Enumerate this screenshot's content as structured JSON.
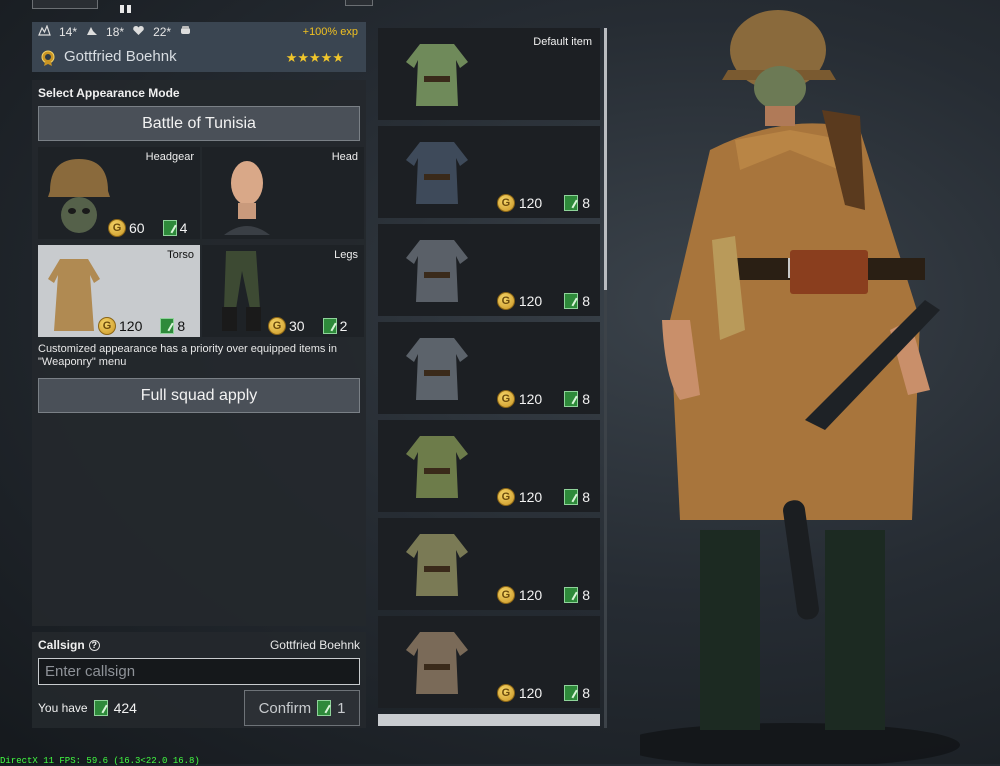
{
  "soldier": {
    "stats": [
      {
        "icon": "perk-points-icon",
        "value": "14*"
      },
      {
        "icon": "speed-icon",
        "value": "18*"
      },
      {
        "icon": "health-icon",
        "value": "22*"
      },
      {
        "icon": "strength-icon",
        "value": ""
      }
    ],
    "exp_bonus": "+100% exp",
    "name": "Gottfried Boehnk",
    "stars": "★★★★★"
  },
  "appearance": {
    "mode_label": "Select Appearance Mode",
    "mode_value": "Battle of Tunisia",
    "slots": [
      {
        "label": "Headgear",
        "price_gold": "60",
        "price_tickets": "4",
        "selected": false
      },
      {
        "label": "Head",
        "price_gold": "",
        "price_tickets": "",
        "selected": false
      },
      {
        "label": "Torso",
        "price_gold": "120",
        "price_tickets": "8",
        "selected": true
      },
      {
        "label": "Legs",
        "price_gold": "30",
        "price_tickets": "2",
        "selected": false
      }
    ],
    "note": "Customized appearance has a priority over equipped items in \"Weaponry\" menu",
    "squad_apply_label": "Full squad apply"
  },
  "callsign": {
    "label": "Callsign",
    "help_icon": "?",
    "current_name": "Gottfried Boehnk",
    "placeholder": "Enter callsign",
    "you_have_label": "You have",
    "you_have_amount": "424",
    "confirm_label": "Confirm",
    "confirm_cost": "1"
  },
  "items": [
    {
      "label": "Default item",
      "price_gold": "",
      "price_tickets": "",
      "color": "#6f8a5a"
    },
    {
      "label": "",
      "price_gold": "120",
      "price_tickets": "8",
      "color": "#3e4a5a"
    },
    {
      "label": "",
      "price_gold": "120",
      "price_tickets": "8",
      "color": "#5a6068"
    },
    {
      "label": "",
      "price_gold": "120",
      "price_tickets": "8",
      "color": "#5c636b"
    },
    {
      "label": "",
      "price_gold": "120",
      "price_tickets": "8",
      "color": "#6d7c4a"
    },
    {
      "label": "",
      "price_gold": "120",
      "price_tickets": "8",
      "color": "#7a7a55"
    },
    {
      "label": "",
      "price_gold": "120",
      "price_tickets": "8",
      "color": "#7a6a58"
    }
  ],
  "coin_letter": "G",
  "debug": {
    "fps_text": "DirectX 11 FPS: 59.6 (16.3<22.0 16.8)"
  },
  "colors": {
    "accent_gold": "#f1c62b",
    "exp": "#f0c020",
    "ticket": "#2e8a3a",
    "fps": "#42ff42"
  }
}
